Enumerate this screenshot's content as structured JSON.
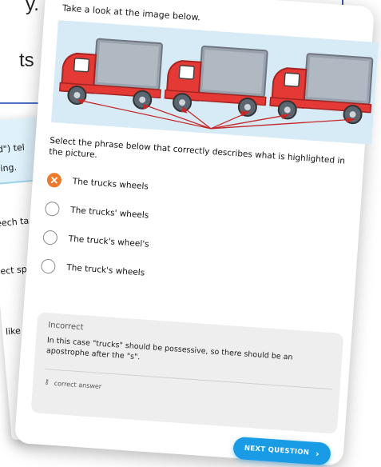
{
  "background": {
    "text_top": "y.",
    "text_mid": "ts",
    "card_snippets": [
      "aid\") tel",
      "thing.",
      "eech ta",
      "ect spe",
      "like \"t"
    ]
  },
  "question": {
    "prompt": "Take a look at the image below.",
    "instruction": "Select the phrase below that correctly describes what is highlighted in the picture.",
    "options": [
      {
        "label": "The trucks wheels",
        "selected": true
      },
      {
        "label": "The trucks' wheels",
        "selected": false
      },
      {
        "label": "The truck's wheel's",
        "selected": false
      },
      {
        "label": "The truck's wheels",
        "selected": false
      }
    ]
  },
  "feedback": {
    "title": "Incorrect",
    "body": "In this case \"trucks\" should be possessive, so there should be an apostrophe after the \"s\".",
    "link_label": "correct answer"
  },
  "next_button": {
    "label": "NEXT QUESTION"
  },
  "colors": {
    "accent": "#1a9be6",
    "selected": "#ee7a2c",
    "truck_cab": "#e53935",
    "truck_box": "#9aa3ad",
    "illustration_bg": "#d7ebf7"
  }
}
